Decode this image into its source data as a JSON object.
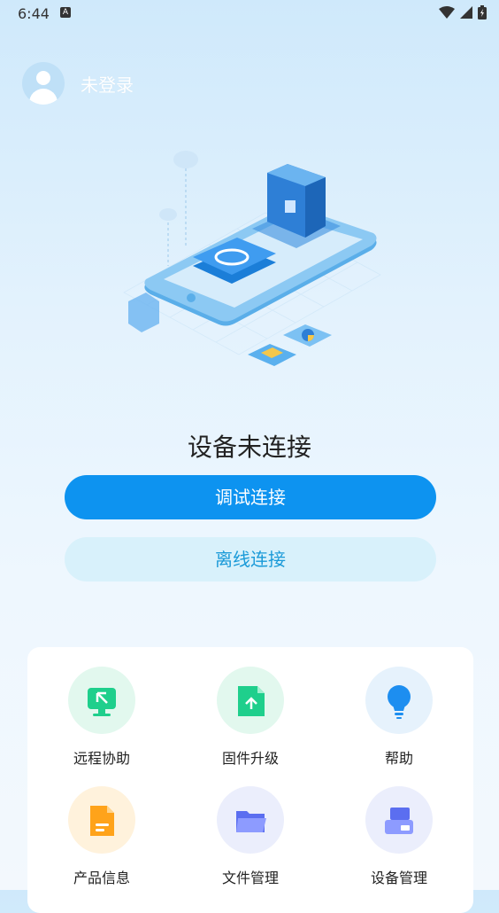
{
  "status_bar": {
    "time": "6:44",
    "notification_badge": "A"
  },
  "user": {
    "name": "未登录"
  },
  "device": {
    "status_text": "设备未连接"
  },
  "buttons": {
    "debug_connect": "调试连接",
    "offline_connect": "离线连接"
  },
  "colors": {
    "primary": "#0d93f0",
    "secondary_bg": "#d8f1fb",
    "secondary_text": "#1a9ad8"
  },
  "functions": [
    {
      "label": "远程协助",
      "icon": "remote-assist-icon",
      "bg": "#e2f8ee",
      "color": "#1fcf8c"
    },
    {
      "label": "固件升级",
      "icon": "firmware-upgrade-icon",
      "bg": "#e2f8ee",
      "color": "#1fcf8c"
    },
    {
      "label": "帮助",
      "icon": "help-bulb-icon",
      "bg": "#e6f2fc",
      "color": "#1d8ef0"
    },
    {
      "label": "产品信息",
      "icon": "product-info-icon",
      "bg": "#fff2dc",
      "color": "#ffa31a"
    },
    {
      "label": "文件管理",
      "icon": "folder-icon",
      "bg": "#ebeefc",
      "color": "#5b6ef0"
    },
    {
      "label": "设备管理",
      "icon": "device-manage-icon",
      "bg": "#ebeefc",
      "color": "#5b6ef0"
    }
  ]
}
